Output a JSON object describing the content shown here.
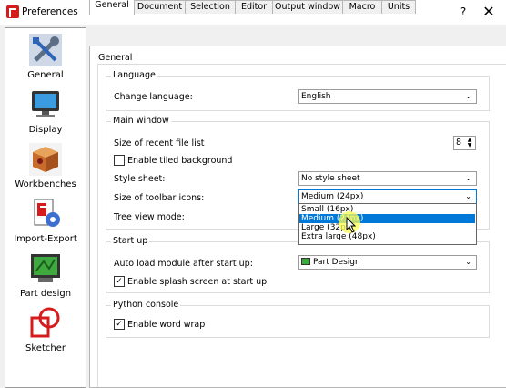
{
  "window": {
    "title": "Preferences",
    "help": "?",
    "close": "✕"
  },
  "pages": [
    {
      "label": "General",
      "icon": "wrench-screwdriver-icon"
    },
    {
      "label": "Display",
      "icon": "monitor-icon"
    },
    {
      "label": "Workbenches",
      "icon": "workbench-cube-icon"
    },
    {
      "label": "Import-Export",
      "icon": "import-export-gear-icon"
    },
    {
      "label": "Part design",
      "icon": "part-design-icon"
    },
    {
      "label": "Sketcher",
      "icon": "sketcher-icon"
    }
  ],
  "tabs": [
    {
      "label": "General"
    },
    {
      "label": "Document"
    },
    {
      "label": "Selection"
    },
    {
      "label": "Editor"
    },
    {
      "label": "Output window"
    },
    {
      "label": "Macro"
    },
    {
      "label": "Units"
    }
  ],
  "panel": {
    "title": "General",
    "language": {
      "title": "Language",
      "label": "Change language:",
      "value": "English"
    },
    "main_window": {
      "title": "Main window",
      "recent_files_label": "Size of recent file list",
      "recent_files_value": "8",
      "tiled_label": "Enable tiled background",
      "tiled_checked": false,
      "style_sheet_label": "Style sheet:",
      "style_sheet_value": "No style sheet",
      "toolbar_icons_label": "Size of toolbar icons:",
      "toolbar_icons_value": "Medium (24px)",
      "toolbar_icons_options": [
        "Small (16px)",
        "Medium (24px)",
        "Large (32px)",
        "Extra large (48px)"
      ],
      "toolbar_icons_selected_index": 1,
      "tree_view_label": "Tree view mode:"
    },
    "startup": {
      "title": "Start up",
      "autoload_label": "Auto load module after start up:",
      "autoload_value": "Part Design",
      "splash_label": "Enable splash screen at start up",
      "splash_checked": true
    },
    "python_console": {
      "title": "Python console",
      "wrap_label": "Enable word wrap",
      "wrap_checked": true
    }
  },
  "colors": {
    "selection": "#0078d7",
    "cursor_highlight": "#ffff50"
  }
}
